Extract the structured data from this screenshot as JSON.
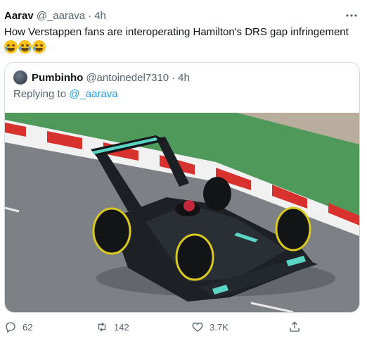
{
  "tweet": {
    "author_name": "Aarav",
    "author_handle": "@_aarava",
    "separator": "·",
    "time": "4h",
    "text": "How Verstappen fans are interoperating Hamilton's DRS gap infringement",
    "emojis": [
      "rolling-on-floor-laughing",
      "loudly-crying-face",
      "rolling-on-floor-laughing"
    ]
  },
  "quote": {
    "author_name": "Pumbinho",
    "author_handle": "@antoinedel7310",
    "separator": "·",
    "time": "4h",
    "replying_prefix": "Replying to",
    "replying_handle": "@_aarava",
    "image_subject": "Mercedes Formula 1 car with oversized exaggerated DRS rear wing on track"
  },
  "actions": {
    "replies": "62",
    "retweets": "142",
    "likes": "3.7K"
  },
  "colors": {
    "text": "#0f1419",
    "muted": "#536471",
    "link": "#1d9bf0",
    "border": "#cfd9de"
  }
}
